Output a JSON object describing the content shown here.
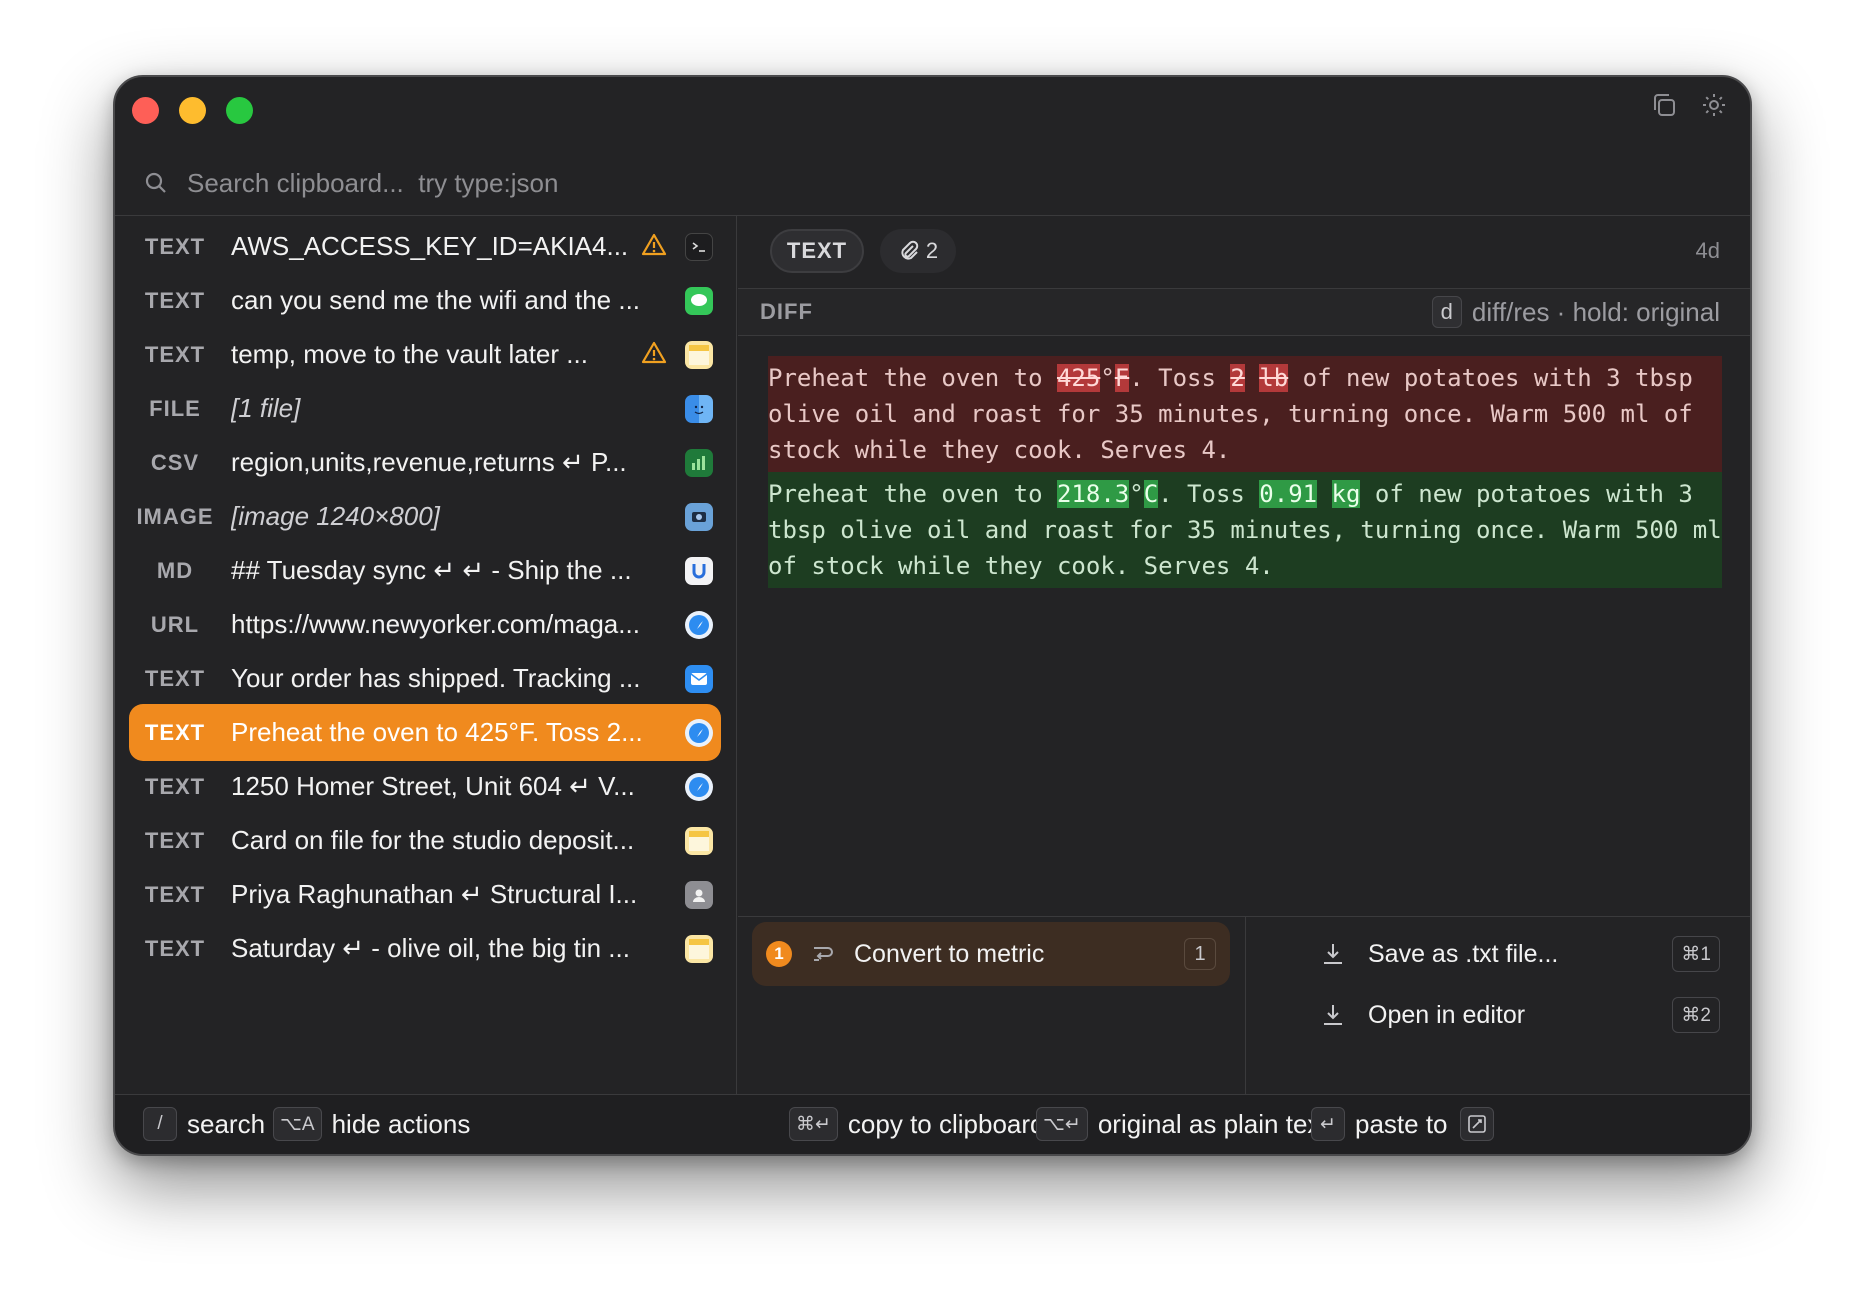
{
  "window": {
    "top_icons": [
      "copy-window-icon",
      "gear-icon"
    ]
  },
  "search": {
    "placeholder": "Search clipboard...  try type:json"
  },
  "list": {
    "items": [
      {
        "type": "TEXT",
        "preview": "AWS_ACCESS_KEY_ID=AKIA4...",
        "warn": true,
        "app": "terminal-icon"
      },
      {
        "type": "TEXT",
        "preview": "can you send me the wifi and the ...",
        "warn": false,
        "app": "messages-icon"
      },
      {
        "type": "TEXT",
        "preview": "temp, move to the vault later ...",
        "warn": true,
        "app": "notes-icon"
      },
      {
        "type": "FILE",
        "preview": "[1 file]",
        "warn": false,
        "app": "finder-icon",
        "italic": true
      },
      {
        "type": "CSV",
        "preview": "region,units,revenue,returns ↵ P...",
        "warn": false,
        "app": "numbers-icon"
      },
      {
        "type": "IMAGE",
        "preview": "[image 1240×800]",
        "warn": false,
        "app": "screenshot-icon",
        "italic": true
      },
      {
        "type": "MD",
        "preview": "## Tuesday sync ↵ ↵ - Ship the ...",
        "warn": false,
        "app": "editor-icon"
      },
      {
        "type": "URL",
        "preview": "https://www.newyorker.com/maga...",
        "warn": false,
        "app": "safari-icon"
      },
      {
        "type": "TEXT",
        "preview": "Your order has shipped. Tracking ...",
        "warn": false,
        "app": "mail-icon"
      },
      {
        "type": "TEXT",
        "preview": "Preheat the oven to 425°F. Toss 2...",
        "warn": false,
        "app": "safari-icon",
        "selected": true
      },
      {
        "type": "TEXT",
        "preview": "1250 Homer Street, Unit 604 ↵ V...",
        "warn": false,
        "app": "safari-icon"
      },
      {
        "type": "TEXT",
        "preview": "Card on file for the studio deposit...",
        "warn": false,
        "app": "notes-icon"
      },
      {
        "type": "TEXT",
        "preview": "Priya Raghunathan ↵ Structural I...",
        "warn": false,
        "app": "contacts-icon"
      },
      {
        "type": "TEXT",
        "preview": "Saturday ↵ - olive oil, the big tin ...",
        "warn": false,
        "app": "notes-icon"
      }
    ]
  },
  "detail": {
    "type_pill": "TEXT",
    "attach_count": "2",
    "age": "4d",
    "diff_label": "DIFF",
    "diff_key": "d",
    "diff_hint": "diff/res · hold: original",
    "old": {
      "pre1": "Preheat the oven to ",
      "del1": "425",
      "mid1": "°",
      "del2": "F",
      "mid2": ". Toss ",
      "del3": "2",
      "mid3": " ",
      "del4": "lb",
      "post": " of new potatoes with 3 tbsp olive oil and roast for 35 minutes, turning once. Warm 500 ml of stock while they cook. Serves 4."
    },
    "new": {
      "pre1": "Preheat the oven to ",
      "ins1": "218.3",
      "mid1": "°",
      "ins2": "C",
      "mid2": ". Toss ",
      "ins3": "0.91",
      "mid3": " ",
      "ins4": "kg",
      "post": " of new potatoes with 3 tbsp olive oil and roast for 35 minutes, turning once. Warm 500 ml of stock while they cook. Serves 4."
    }
  },
  "actions": {
    "primary": {
      "num": "1",
      "label": "Convert to metric",
      "shortcut": "1"
    },
    "secondary": [
      {
        "label": "Save as .txt file...",
        "shortcut": "⌘1"
      },
      {
        "label": "Open in editor",
        "shortcut": "⌘2"
      }
    ]
  },
  "footer": {
    "search_key": "/",
    "search_label": "search",
    "actions_key": "⌥A",
    "actions_label": "hide actions",
    "copy_key": "⌘↵",
    "copy_label": "copy to clipboard",
    "plain_key": "⌥↵",
    "plain_label": "original as plain text",
    "paste_key": "↵",
    "paste_label": "paste to"
  },
  "colors": {
    "accent": "#f08a1e",
    "background": "#232325",
    "diff_removed": "#4a1f1f",
    "diff_added": "#1d3d21"
  }
}
